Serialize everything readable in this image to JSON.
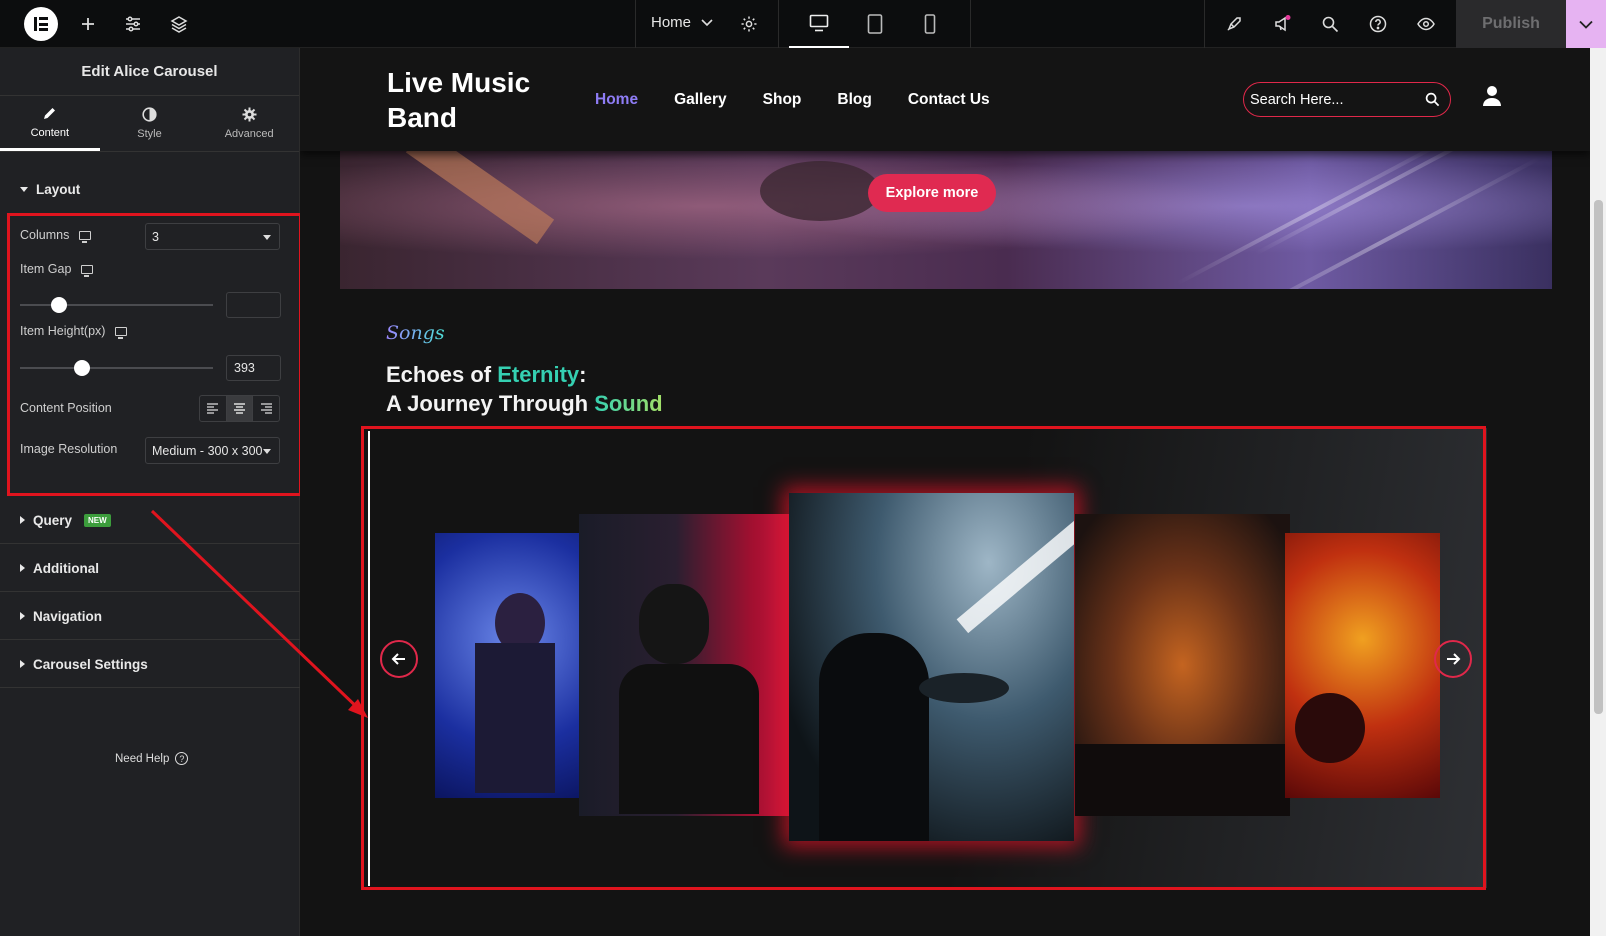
{
  "topbar": {
    "page_name": "Home",
    "publish_label": "Publish",
    "icons": [
      "elementor-logo-icon",
      "plus-icon",
      "sliders-icon",
      "layers-icon",
      "chevron-down-icon",
      "gear-icon",
      "desktop-icon",
      "tablet-icon",
      "mobile-icon",
      "rocket-icon",
      "megaphone-icon",
      "search-icon",
      "help-icon",
      "eye-icon",
      "chevron-down-icon"
    ]
  },
  "panel": {
    "title": "Edit Alice Carousel",
    "tabs": [
      {
        "label": "Content",
        "icon": "pencil-icon"
      },
      {
        "label": "Style",
        "icon": "contrast-icon"
      },
      {
        "label": "Advanced",
        "icon": "gear-icon"
      }
    ],
    "layout_section": "Layout",
    "columns_label": "Columns",
    "columns_value": "3",
    "item_gap_label": "Item Gap",
    "item_gap_value": "",
    "item_gap_level": 0.2,
    "item_height_label": "Item Height(px)",
    "item_height_value": "393",
    "item_height_level": 0.32,
    "content_position_label": "Content Position",
    "content_position_selected": "center",
    "image_resolution_label": "Image Resolution",
    "image_resolution_value": "Medium - 300 x 300",
    "sections": [
      "Query",
      "Additional",
      "Navigation",
      "Carousel Settings"
    ],
    "new_badge": "NEW",
    "help_label": "Need Help",
    "help_glyph": "?"
  },
  "site": {
    "brand": "Live Music Band",
    "nav": [
      "Home",
      "Gallery",
      "Shop",
      "Blog",
      "Contact Us"
    ],
    "active_nav": "Home",
    "search_placeholder": "Search Here...",
    "hero_button": "Explore more",
    "songs_label": "Songs",
    "heading_line1_a": "Echoes of ",
    "heading_line1_b": "Eternity",
    "heading_line1_c": ":",
    "heading_line2_a": "A Journey Through ",
    "heading_line2_b": "Sound"
  },
  "colors": {
    "accent": "#e0284a",
    "nav_active": "#8e7cf5",
    "highlight": "#35d0b2",
    "annotation_red": "#e0141e",
    "publish_arrow_bg": "#e6b3f2"
  }
}
